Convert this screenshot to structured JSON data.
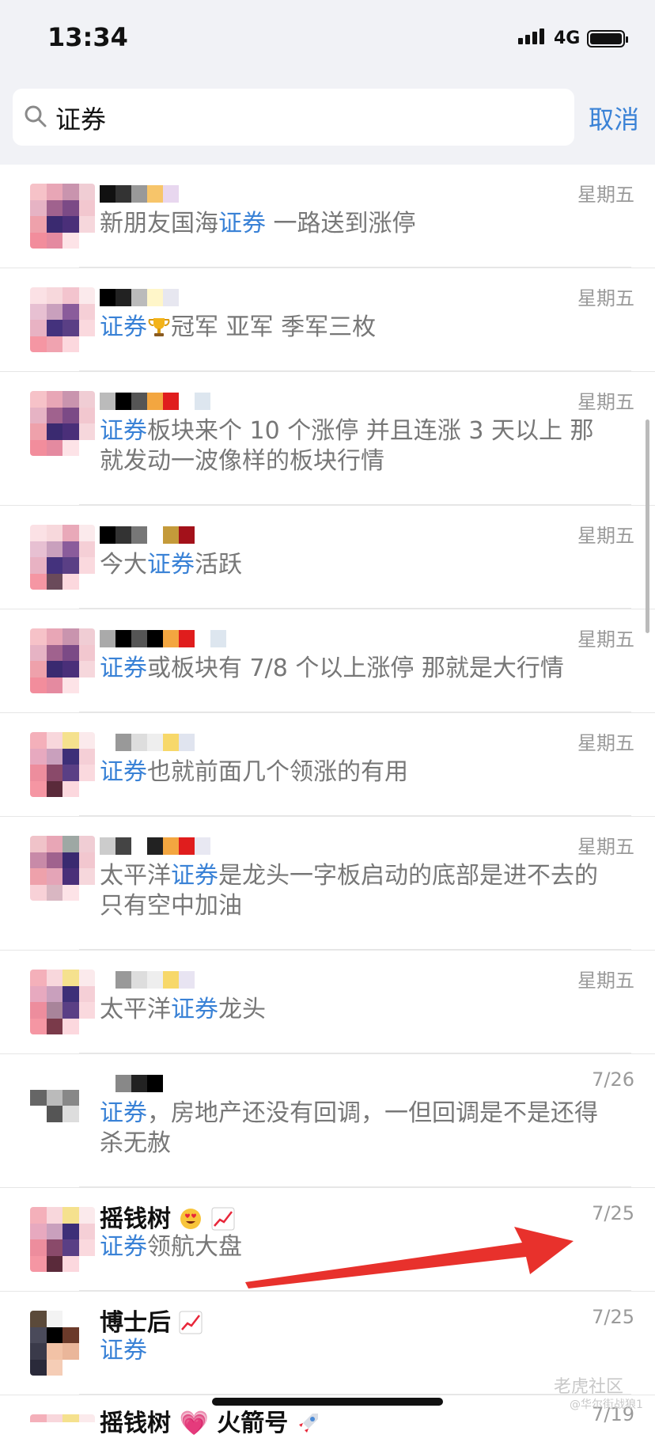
{
  "status_bar": {
    "time": "13:34",
    "network": "4G"
  },
  "search": {
    "query": "证券",
    "cancel_label": "取消"
  },
  "results": [
    {
      "date": "星期五",
      "before": "新朋友国海",
      "highlight": "证券",
      "after": " 一路送到涨停"
    },
    {
      "date": "星期五",
      "before": "",
      "highlight": "证券",
      "after": "冠军 亚军 季军三枚"
    },
    {
      "date": "星期五",
      "before": "",
      "highlight": "证券",
      "after": "板块来个 10 个涨停 并且连涨 3 天以上 那就发动一波像样的板块行情"
    },
    {
      "date": "星期五",
      "before": "今大",
      "highlight": "证券",
      "after": "活跃"
    },
    {
      "date": "星期五",
      "before": "",
      "highlight": "证券",
      "after": "或板块有 7/8 个以上涨停 那就是大行情"
    },
    {
      "date": "星期五",
      "before": "",
      "highlight": "证券",
      "after": "也就前面几个领涨的有用"
    },
    {
      "date": "星期五",
      "before": "太平洋",
      "highlight": "证券",
      "after": "是龙头一字板启动的底部是进不去的 只有空中加油"
    },
    {
      "date": "星期五",
      "before": "太平洋",
      "highlight": "证券",
      "after": "龙头"
    },
    {
      "date": "7/26",
      "before": "",
      "highlight": "证券",
      "after": "，房地产还没有回调，一但回调是不是还得杀无赦"
    },
    {
      "date": "7/25",
      "name": "摇钱树",
      "before": "",
      "highlight": "证券",
      "after": "领航大盘"
    },
    {
      "date": "7/25",
      "name": "博士后",
      "before": "",
      "highlight": "证券",
      "after": ""
    },
    {
      "date": "7/19",
      "name": "摇钱树",
      "name_suffix": "火箭号"
    }
  ],
  "watermark": {
    "brand": "老虎社区",
    "user": "@华尔街战狼1"
  },
  "colors": {
    "highlight": "#3a82d6",
    "arrow": "#e8312c",
    "search_bg": "#f1f2f6"
  },
  "icons": [
    "search-icon",
    "trophy-icon",
    "heart-eyes-emoji-icon",
    "chart-increasing-icon",
    "rocket-icon",
    "red-arrow-icon"
  ]
}
